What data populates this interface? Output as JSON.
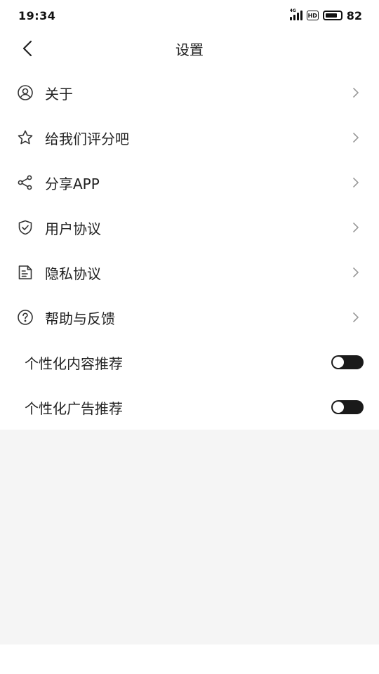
{
  "status": {
    "time": "19:34",
    "network": "4G",
    "hd": "HD",
    "battery": "82",
    "battery_level": 0.82
  },
  "nav": {
    "title": "设置",
    "back_icon": "chevron-left-icon"
  },
  "menu": [
    {
      "label": "关于",
      "icon": "user-circle-icon"
    },
    {
      "label": "给我们评分吧",
      "icon": "star-outline-icon"
    },
    {
      "label": "分享APP",
      "icon": "share-icon"
    },
    {
      "label": "用户协议",
      "icon": "shield-check-icon"
    },
    {
      "label": "隐私协议",
      "icon": "document-icon"
    },
    {
      "label": "帮助与反馈",
      "icon": "help-circle-icon"
    }
  ],
  "toggles": [
    {
      "label": "个性化内容推荐",
      "on": false
    },
    {
      "label": "个性化广告推荐",
      "on": false
    }
  ],
  "colors": {
    "toggle_track": "#1a1a1a",
    "background_gray": "#f5f5f5",
    "text": "#222222",
    "chevron": "#999999"
  }
}
